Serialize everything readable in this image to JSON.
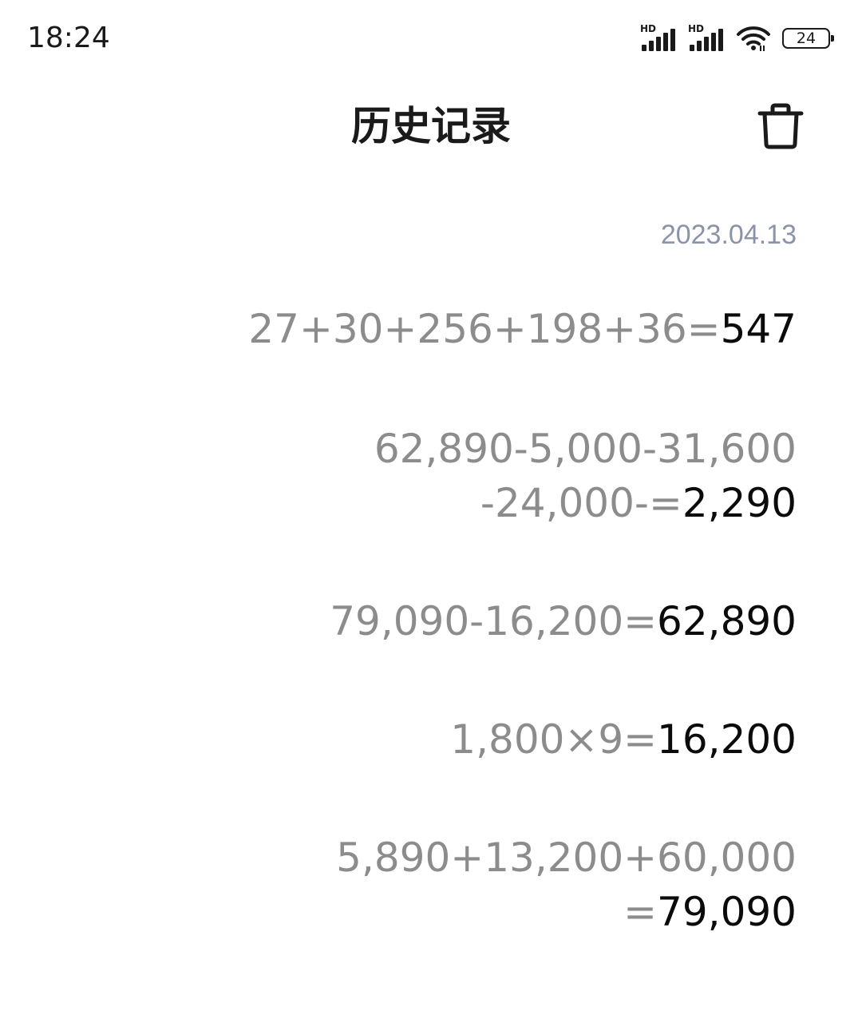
{
  "status_bar": {
    "time": "18:24",
    "signal_1_label": "HD",
    "signal_2_label": "HD",
    "battery_level": "24"
  },
  "header": {
    "title": "历史记录"
  },
  "history": {
    "date": "2023.04.13",
    "entries": [
      {
        "lines": [
          {
            "expr": "27+30+256+198+36=",
            "result": "547"
          }
        ]
      },
      {
        "lines": [
          {
            "expr": "62,890-5,000-31,600",
            "result": ""
          },
          {
            "expr": "-24,000-=",
            "result": "2,290"
          }
        ]
      },
      {
        "lines": [
          {
            "expr": "79,090-16,200=",
            "result": "62,890"
          }
        ]
      },
      {
        "lines": [
          {
            "expr": "1,800×9=",
            "result": "16,200"
          }
        ]
      },
      {
        "lines": [
          {
            "expr": "5,890+13,200+60,000",
            "result": ""
          },
          {
            "expr": "=",
            "result": "79,090"
          }
        ]
      }
    ]
  },
  "colors": {
    "expression": "#8c8c8c",
    "result": "#0b0b0b",
    "date": "#8a93a8"
  },
  "icons": {
    "delete": "trash-icon",
    "wifi": "wifi-icon",
    "battery": "battery-icon",
    "signal": "signal-icon"
  }
}
